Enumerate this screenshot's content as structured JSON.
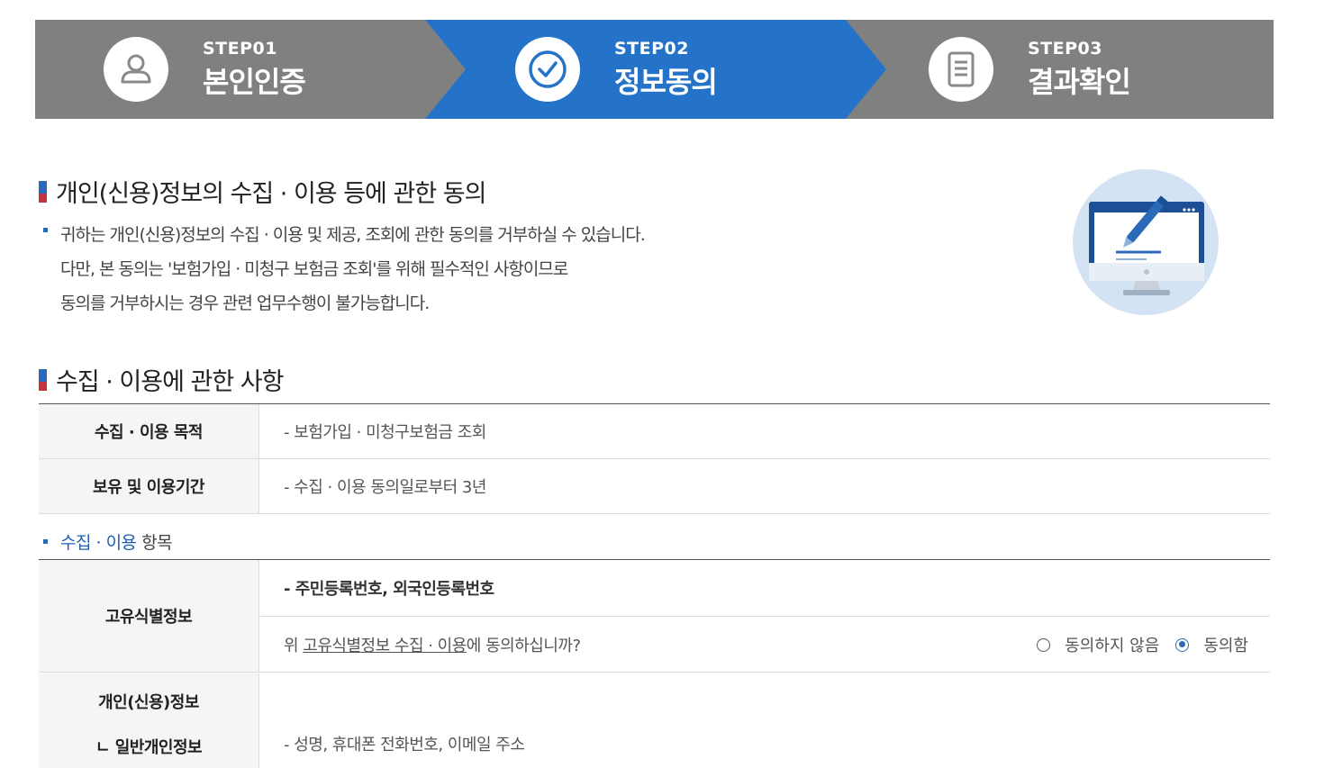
{
  "colors": {
    "step_inactive": "#808080",
    "step_active": "#2573c9",
    "accent_blue": "#2a6ab8",
    "accent_red": "#c8323c"
  },
  "steps": [
    {
      "num": "STEP01",
      "title": "본인인증",
      "icon": "user-icon",
      "active": false
    },
    {
      "num": "STEP02",
      "title": "정보동의",
      "icon": "check-circle-icon",
      "active": true
    },
    {
      "num": "STEP03",
      "title": "결과확인",
      "icon": "document-icon",
      "active": false
    }
  ],
  "consent": {
    "heading": "개인(신용)정보의 수집 · 이용 등에 관한 동의",
    "lines": [
      "귀하는 개인(신용)정보의 수집 · 이용 및 제공, 조회에 관한 동의를 거부하실 수 있습니다.",
      "다만, 본 동의는 '보험가입 · 미청구 보험금 조회'를 위해 필수적인 사항이므로",
      "동의를 거부하시는 경우 관련 업무수행이 불가능합니다."
    ],
    "illustration_icon": "monitor-pen-icon"
  },
  "collection": {
    "heading": "수집 · 이용에 관한 사항",
    "rows": [
      {
        "label": "수집 · 이용 목적",
        "value": "- 보험가입 · 미청구보험금 조회"
      },
      {
        "label": "보유 및 이용기간",
        "value": "- 수집 · 이용 동의일로부터 3년"
      }
    ]
  },
  "items": {
    "bullet_blue": "수집 · 이용",
    "bullet_rest": " 항목",
    "unique": {
      "label": "고유식별정보",
      "value": "- 주민등록번호, 외국인등록번호",
      "question_prefix": "위 ",
      "question_link": "고유식별정보 수집 · 이용",
      "question_suffix": "에 동의하십니까?",
      "option_disagree": "동의하지 않음",
      "option_agree": "동의함",
      "selected": "동의함"
    },
    "personal": {
      "label_line1": "개인(신용)정보",
      "label_line2": "ㄴ 일반개인정보",
      "value": "- 성명, 휴대폰 전화번호, 이메일 주소"
    }
  }
}
